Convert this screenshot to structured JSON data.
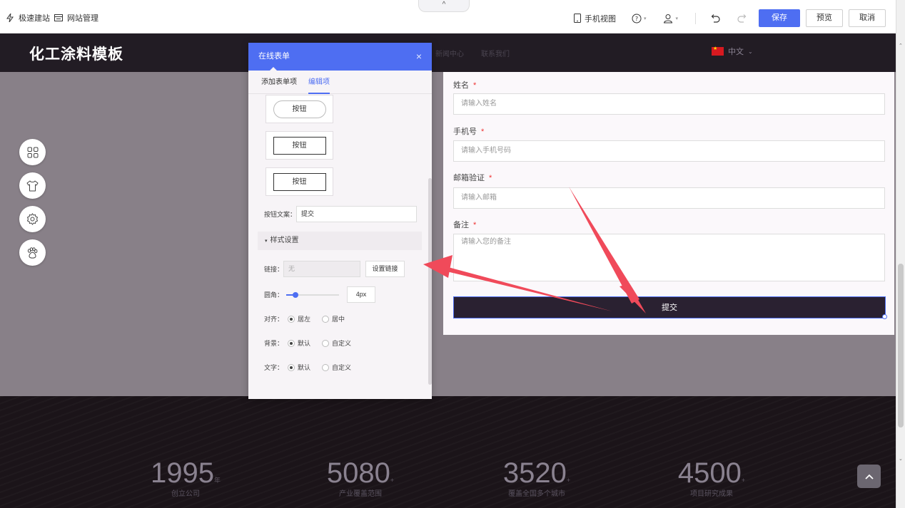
{
  "toolbar": {
    "quick_build": "极速建站",
    "site_manage": "网站管理",
    "mobile_view": "手机视图",
    "save": "保存",
    "preview": "预览",
    "cancel": "取消",
    "collapse_glyph": "^"
  },
  "site": {
    "logo": "化工涂料模板",
    "nav_faint_1": "新闻中心",
    "nav_faint_2": "联系我们",
    "language": "中文"
  },
  "form": {
    "fields": [
      {
        "label": "姓名",
        "placeholder": "请输入姓名"
      },
      {
        "label": "手机号",
        "placeholder": "请输入手机号码"
      },
      {
        "label": "邮箱验证",
        "placeholder": "请输入邮箱"
      },
      {
        "label": "备注",
        "placeholder": "请输入您的备注"
      }
    ],
    "required_mark": "*",
    "submit": "提交"
  },
  "panel": {
    "title": "在线表单",
    "close": "×",
    "tabs": [
      "添加表单项",
      "编辑项"
    ],
    "active_tab": 1,
    "button_styles": [
      "按钮",
      "按钮",
      "按钮"
    ],
    "button_text_label": "按钮文案：",
    "button_text_value": "提交",
    "style_section": "样式设置",
    "link_label": "链接：",
    "link_value": "无",
    "set_link": "设置链接",
    "radius_label": "圆角：",
    "radius_value": "4px",
    "radius_level": 0.18,
    "align_label": "对齐：",
    "align_options": [
      "居左",
      "居中"
    ],
    "bg_label": "背景：",
    "bg_options": [
      "默认",
      "自定义"
    ],
    "text_label": "文字：",
    "text_options": [
      "默认",
      "自定义"
    ]
  },
  "stats": [
    {
      "num": "1995",
      "suffix": "年",
      "label": "创立公司"
    },
    {
      "num": "5080",
      "suffix": "+",
      "label": "产业覆盖范围"
    },
    {
      "num": "3520",
      "suffix": "+",
      "label": "覆盖全国多个城市"
    },
    {
      "num": "4500",
      "suffix": "+",
      "label": "项目研究成果"
    }
  ],
  "colors": {
    "accent": "#4e6ef2",
    "header_bg": "#221c24",
    "annotation_arrow": "#f04a5a"
  }
}
